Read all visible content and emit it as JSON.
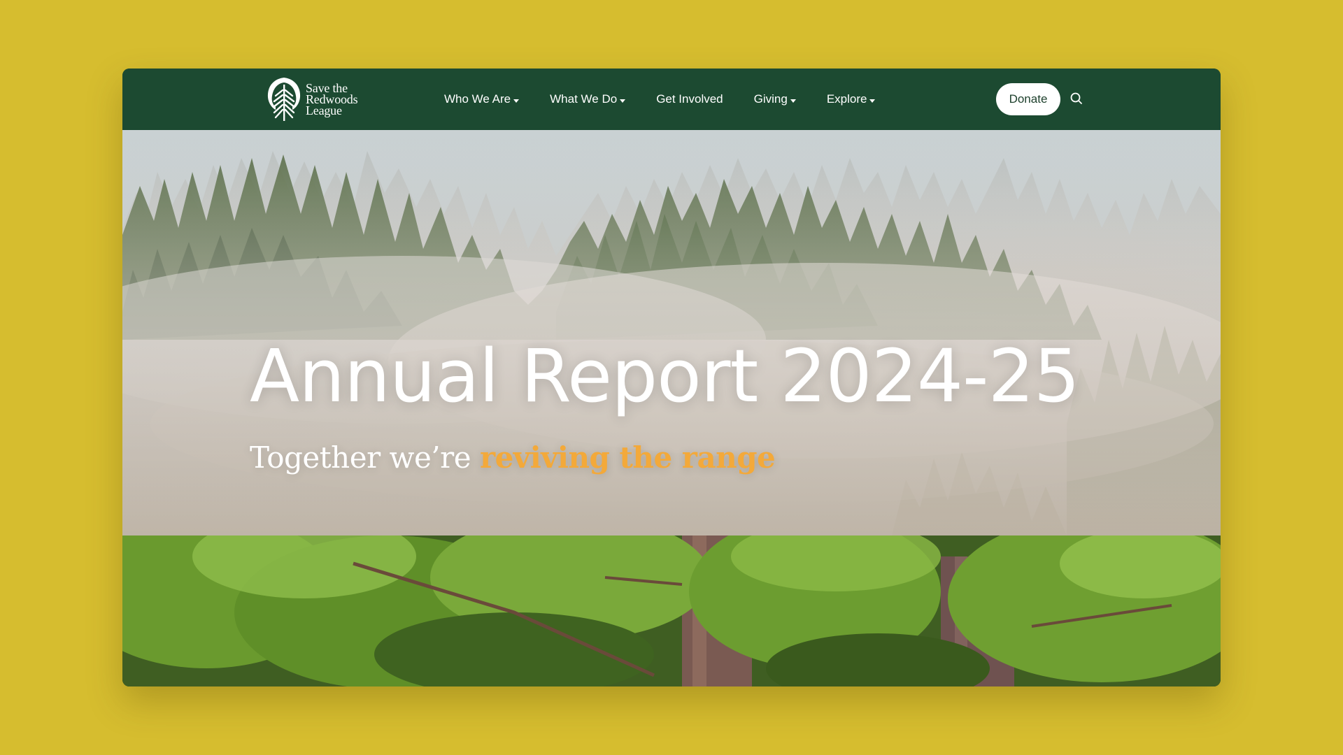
{
  "brand": {
    "logo_lines": [
      "Save the",
      "Redwoods",
      "League"
    ]
  },
  "nav": {
    "items": [
      {
        "label": "Who We Are",
        "has_dropdown": true
      },
      {
        "label": "What We Do",
        "has_dropdown": true
      },
      {
        "label": "Get Involved",
        "has_dropdown": false
      },
      {
        "label": "Giving",
        "has_dropdown": true
      },
      {
        "label": "Explore",
        "has_dropdown": true
      }
    ],
    "donate_label": "Donate",
    "search_icon": "search-icon"
  },
  "hero": {
    "title": "Annual Report 2024-25",
    "subtitle_prefix": "Together we’re ",
    "subtitle_accent": "reviving the range"
  },
  "colors": {
    "page_background": "#d6bd2f",
    "nav_background": "#1c4a31",
    "accent": "#f3a93a",
    "text_light": "#ffffff"
  }
}
